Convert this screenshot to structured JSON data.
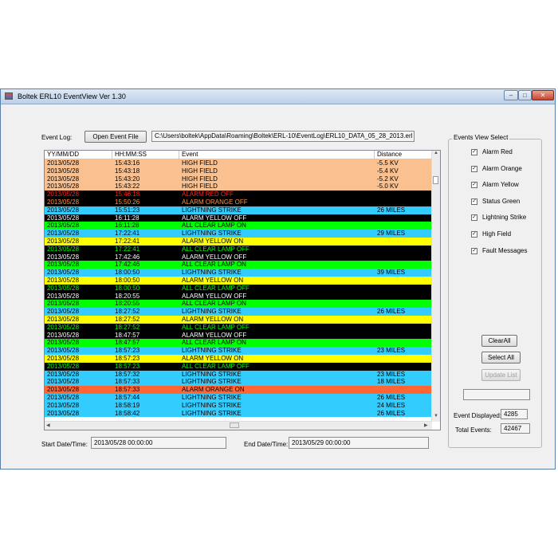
{
  "window": {
    "title": "Boltek ERL10 EventView Ver 1.30",
    "controls": {
      "minimize": "–",
      "maximize": "□",
      "close": "✕"
    }
  },
  "toolbar": {
    "event_log_label": "Event Log:",
    "open_button": "Open Event File",
    "file_path": "C:\\Users\\boltek\\AppData\\Roaming\\Boltek\\ERL-10\\EventLog\\ERL10_DATA_05_28_2013.erl"
  },
  "table": {
    "columns": [
      "YY/MM/DD",
      "HH:MM:SS",
      "Event",
      "Distance"
    ],
    "rows": [
      {
        "date": "2013/05/28",
        "time": "15:43:16",
        "event": "HIGH FIELD",
        "distance": "-5.5 KV",
        "bg": "#fac090",
        "fg": "#000000"
      },
      {
        "date": "2013/05/28",
        "time": "15:43:18",
        "event": "HIGH FIELD",
        "distance": "-5.4 KV",
        "bg": "#fac090",
        "fg": "#000000"
      },
      {
        "date": "2013/05/28",
        "time": "15:43:20",
        "event": "HIGH FIELD",
        "distance": "-5.2 KV",
        "bg": "#fac090",
        "fg": "#000000"
      },
      {
        "date": "2013/05/28",
        "time": "15:43:22",
        "event": "HIGH FIELD",
        "distance": "-5.0 KV",
        "bg": "#fac090",
        "fg": "#000000"
      },
      {
        "date": "2013/05/28",
        "time": "15:46:18",
        "event": "ALARM RED OFF",
        "distance": "",
        "bg": "#000000",
        "fg": "#ff2020"
      },
      {
        "date": "2013/05/28",
        "time": "15:50:26",
        "event": "ALARM ORANGE OFF",
        "distance": "",
        "bg": "#000000",
        "fg": "#ff9040"
      },
      {
        "date": "2013/05/28",
        "time": "15:51:23",
        "event": "LIGHTNING STRIKE",
        "distance": "26 MILES",
        "bg": "#33ccff",
        "fg": "#000000"
      },
      {
        "date": "2013/05/28",
        "time": "16:11:28",
        "event": "ALARM YELLOW OFF",
        "distance": "",
        "bg": "#000000",
        "fg": "#ffffff"
      },
      {
        "date": "2013/05/28",
        "time": "16:11:28",
        "event": "ALL CLEAR LAMP ON",
        "distance": "",
        "bg": "#00ff00",
        "fg": "#000000"
      },
      {
        "date": "2013/05/28",
        "time": "17:22:41",
        "event": "LIGHTNING STRIKE",
        "distance": "29 MILES",
        "bg": "#33ccff",
        "fg": "#000000"
      },
      {
        "date": "2013/05/28",
        "time": "17:22:41",
        "event": "ALARM YELLOW ON",
        "distance": "",
        "bg": "#ffff00",
        "fg": "#000000"
      },
      {
        "date": "2013/05/28",
        "time": "17:22:41",
        "event": "ALL CLEAR LAMP OFF",
        "distance": "",
        "bg": "#000000",
        "fg": "#00ff00"
      },
      {
        "date": "2013/05/28",
        "time": "17:42:46",
        "event": "ALARM YELLOW OFF",
        "distance": "",
        "bg": "#000000",
        "fg": "#ffffff"
      },
      {
        "date": "2013/05/28",
        "time": "17:42:46",
        "event": "ALL CLEAR LAMP ON",
        "distance": "",
        "bg": "#00ff00",
        "fg": "#000000"
      },
      {
        "date": "2013/05/28",
        "time": "18:00:50",
        "event": "LIGHTNING STRIKE",
        "distance": "39 MILES",
        "bg": "#33ccff",
        "fg": "#000000"
      },
      {
        "date": "2013/05/28",
        "time": "18:00:50",
        "event": "ALARM YELLOW ON",
        "distance": "",
        "bg": "#ffff00",
        "fg": "#000000"
      },
      {
        "date": "2013/05/28",
        "time": "18:00:50",
        "event": "ALL CLEAR LAMP OFF",
        "distance": "",
        "bg": "#000000",
        "fg": "#00ff00"
      },
      {
        "date": "2013/05/28",
        "time": "18:20:55",
        "event": "ALARM YELLOW OFF",
        "distance": "",
        "bg": "#000000",
        "fg": "#ffffff"
      },
      {
        "date": "2013/05/28",
        "time": "18:20:55",
        "event": "ALL CLEAR LAMP ON",
        "distance": "",
        "bg": "#00ff00",
        "fg": "#000000"
      },
      {
        "date": "2013/05/28",
        "time": "18:27:52",
        "event": "LIGHTNING STRIKE",
        "distance": "26 MILES",
        "bg": "#33ccff",
        "fg": "#000000"
      },
      {
        "date": "2013/05/28",
        "time": "18:27:52",
        "event": "ALARM YELLOW ON",
        "distance": "",
        "bg": "#ffff00",
        "fg": "#000000"
      },
      {
        "date": "2013/05/28",
        "time": "18:27:52",
        "event": "ALL CLEAR LAMP OFF",
        "distance": "",
        "bg": "#000000",
        "fg": "#00ff00"
      },
      {
        "date": "2013/05/28",
        "time": "18:47:57",
        "event": "ALARM YELLOW OFF",
        "distance": "",
        "bg": "#000000",
        "fg": "#ffffff"
      },
      {
        "date": "2013/05/28",
        "time": "18:47:57",
        "event": "ALL CLEAR LAMP ON",
        "distance": "",
        "bg": "#00ff00",
        "fg": "#000000"
      },
      {
        "date": "2013/05/28",
        "time": "18:57:23",
        "event": "LIGHTNING STRIKE",
        "distance": "23 MILES",
        "bg": "#33ccff",
        "fg": "#000000"
      },
      {
        "date": "2013/05/28",
        "time": "18:57:23",
        "event": "ALARM YELLOW ON",
        "distance": "",
        "bg": "#ffff00",
        "fg": "#000000"
      },
      {
        "date": "2013/05/28",
        "time": "18:57:23",
        "event": "ALL CLEAR LAMP OFF",
        "distance": "",
        "bg": "#000000",
        "fg": "#00ff00"
      },
      {
        "date": "2013/05/28",
        "time": "18:57:32",
        "event": "LIGHTNING STRIKE",
        "distance": "23 MILES",
        "bg": "#33ccff",
        "fg": "#000000"
      },
      {
        "date": "2013/05/28",
        "time": "18:57:33",
        "event": "LIGHTNING STRIKE",
        "distance": "18 MILES",
        "bg": "#33ccff",
        "fg": "#000000"
      },
      {
        "date": "2013/05/28",
        "time": "18:57:33",
        "event": "ALARM ORANGE ON",
        "distance": "",
        "bg": "#ff6633",
        "fg": "#000000"
      },
      {
        "date": "2013/05/28",
        "time": "18:57:44",
        "event": "LIGHTNING STRIKE",
        "distance": "26 MILES",
        "bg": "#33ccff",
        "fg": "#000000"
      },
      {
        "date": "2013/05/28",
        "time": "18:58:19",
        "event": "LIGHTNING STRIKE",
        "distance": "24 MILES",
        "bg": "#33ccff",
        "fg": "#000000"
      },
      {
        "date": "2013/05/28",
        "time": "18:58:42",
        "event": "LIGHTNING STRIKE",
        "distance": "26 MILES",
        "bg": "#33ccff",
        "fg": "#000000"
      }
    ]
  },
  "footer": {
    "start_label": "Start Date/Time:",
    "start_value": "2013/05/28   00:00:00",
    "end_label": "End Date/Time:",
    "end_value": "2013/05/29   00:00:00"
  },
  "events_view": {
    "title": "Events View Select",
    "items": [
      {
        "label": "Alarm Red",
        "checked": true
      },
      {
        "label": "Alarm Orange",
        "checked": true
      },
      {
        "label": "Alarm Yellow",
        "checked": true
      },
      {
        "label": "Status Green",
        "checked": true
      },
      {
        "label": "Lightning Strike",
        "checked": true
      },
      {
        "label": "High Field",
        "checked": true
      },
      {
        "label": "Fault Messages",
        "checked": true
      }
    ],
    "clear_all": "ClearAll",
    "select_all": "Select All",
    "update_list": "Update List",
    "events_displayed_label": "Event Displayed:",
    "events_displayed": "4285",
    "total_events_label": "Total Events:",
    "total_events": "42467"
  }
}
